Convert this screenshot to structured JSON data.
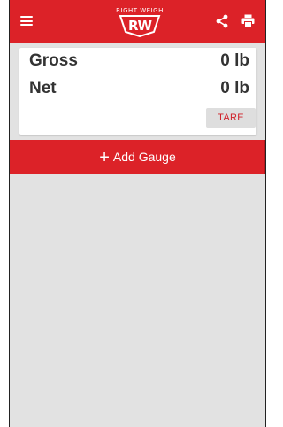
{
  "app": {
    "logo_text": "RIGHT WEIGH",
    "logo_letters": "RW",
    "brand_color": "#dc2228"
  },
  "toolbar": {
    "menu_icon": "hamburger-menu-icon",
    "share_icon": "share-icon",
    "print_icon": "print-icon"
  },
  "readings": {
    "gross_label": "Gross",
    "gross_value": "0 lb",
    "net_label": "Net",
    "net_value": "0 lb",
    "tare_label": "TARE"
  },
  "actions": {
    "add_gauge_label": "Add Gauge",
    "add_gauge_symbol": "+"
  }
}
